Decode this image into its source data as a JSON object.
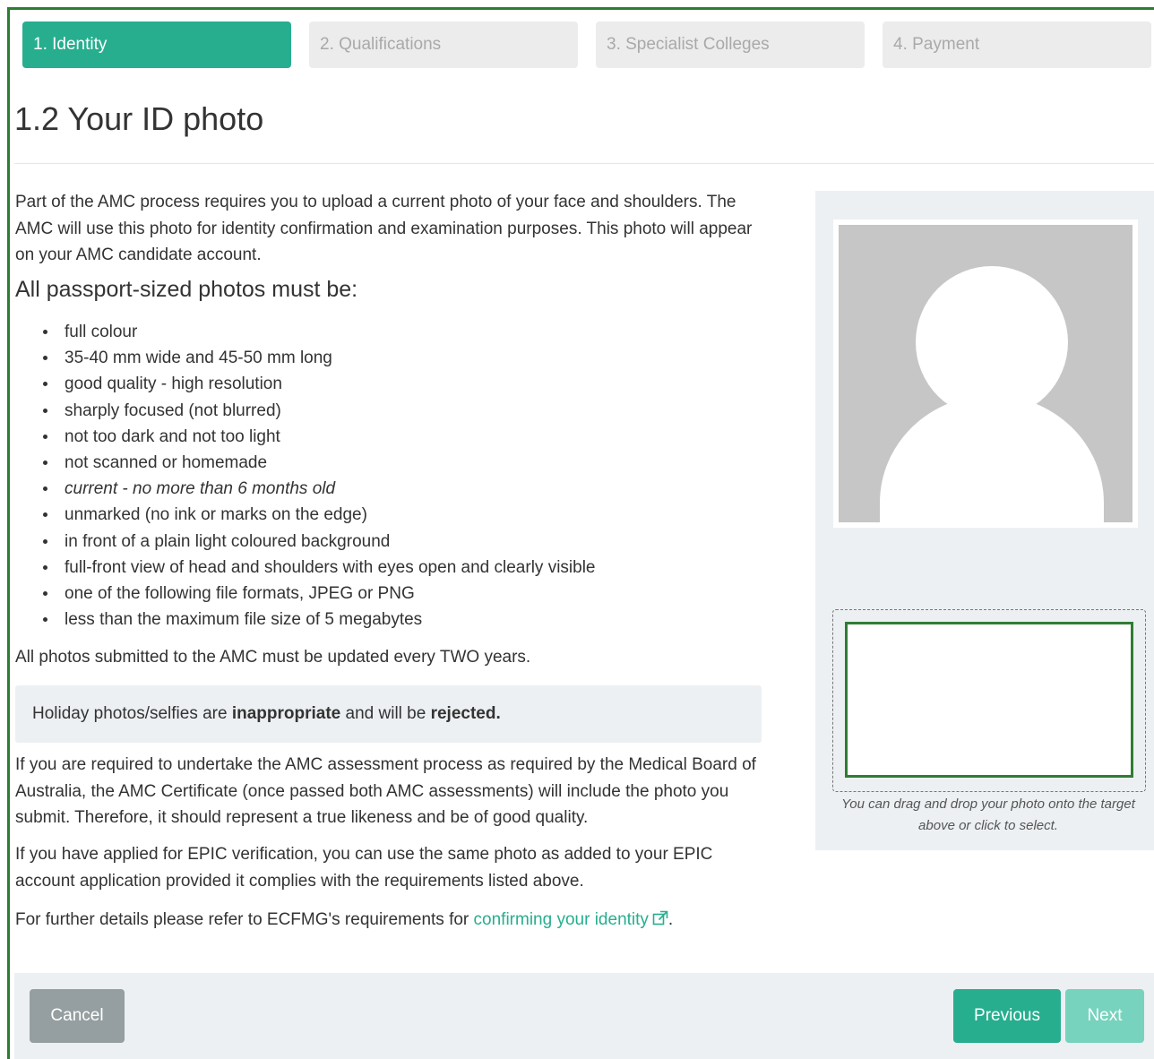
{
  "steps": [
    {
      "label": "1. Identity",
      "state": "active"
    },
    {
      "label": "2. Qualifications",
      "state": "inactive"
    },
    {
      "label": "3. Specialist Colleges",
      "state": "inactive"
    },
    {
      "label": "4. Payment",
      "state": "inactive"
    }
  ],
  "page_title": "1.2 Your ID photo",
  "intro": "Part of the AMC process requires you to upload a current photo of your face and shoulders. The AMC will use this photo for identity confirmation and examination purposes. This photo will appear on your AMC candidate account.",
  "requirements_heading": "All passport-sized photos must be:",
  "requirements": [
    "full colour",
    "35-40 mm wide and 45-50 mm long",
    "good quality - high resolution",
    "sharply focused (not blurred)",
    "not too dark and not too light",
    "not scanned or homemade",
    "current - no more than 6 months old",
    "unmarked (no ink or marks on the edge)",
    "in front of a plain light coloured background",
    "full-front view of head and shoulders with eyes open and clearly visible",
    "one of the following file formats, JPEG or PNG",
    "less than the maximum file size of 5 megabytes"
  ],
  "update_note": "All photos submitted to the AMC must be updated every TWO years.",
  "alert": {
    "prefix": "Holiday photos/selfies are ",
    "bold1": "inappropriate",
    "middle": " and will be ",
    "bold2": "rejected."
  },
  "certificate_note": "If you are required to undertake the AMC assessment process as required by the Medical Board of Australia, the AMC Certificate (once passed both AMC assessments) will include the photo you submit. Therefore, it should represent a true likeness and be of good quality.",
  "epic_note": "If you have applied for EPIC verification, you can use the same photo as added to your EPIC account application provided it complies with the requirements listed above.",
  "further": {
    "prefix": "For further details please refer to ECFMG's requirements for ",
    "link_text": "confirming your identity",
    "suffix": "."
  },
  "drop_hint": "You can drag and drop your photo onto the target above or click to select.",
  "buttons": {
    "cancel": "Cancel",
    "previous": "Previous",
    "next": "Next"
  },
  "colors": {
    "accent": "#27ae8f",
    "highlight_border": "#2f7d32",
    "panel_bg": "#edf0f2"
  },
  "icons": [
    "external-link-icon",
    "avatar-placeholder-icon"
  ]
}
